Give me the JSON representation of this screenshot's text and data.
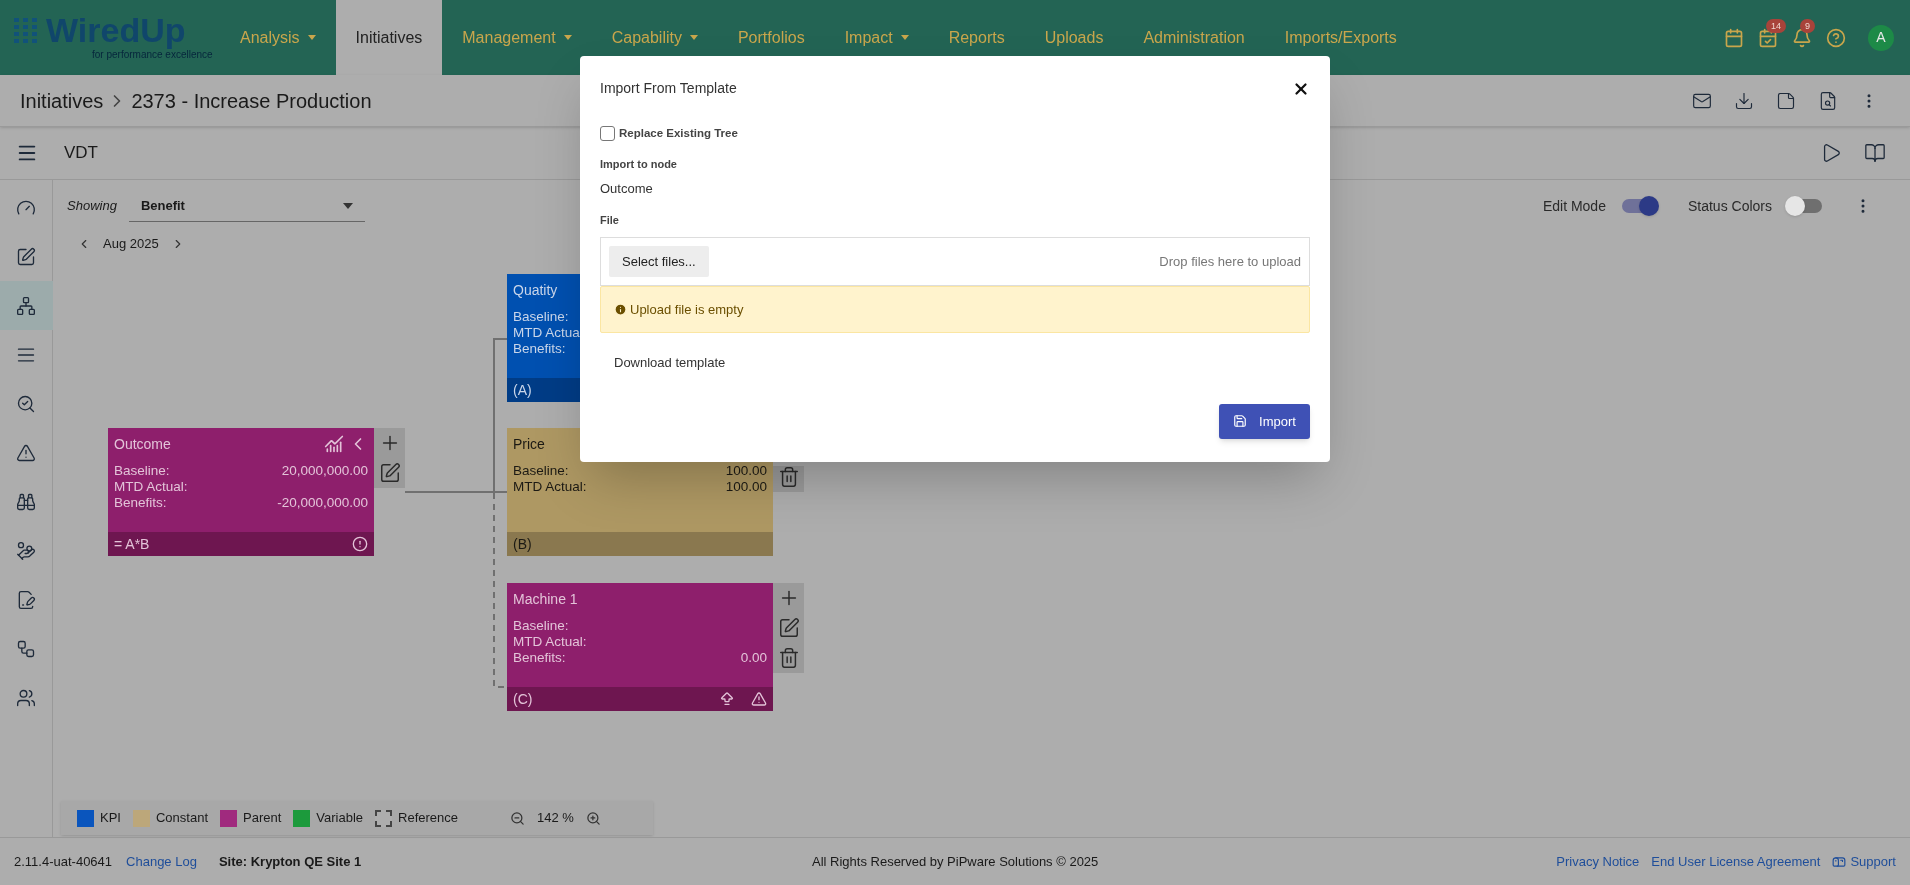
{
  "header": {
    "logo": "WiredUp",
    "tagline": "for performance excellence",
    "nav": [
      {
        "label": "Analysis",
        "selected": false,
        "dropdown": true
      },
      {
        "label": "Initiatives",
        "selected": true,
        "dropdown": false
      },
      {
        "label": "Management",
        "selected": false,
        "dropdown": true
      },
      {
        "label": "Capability",
        "selected": false,
        "dropdown": true
      },
      {
        "label": "Portfolios",
        "selected": false,
        "dropdown": false
      },
      {
        "label": "Impact",
        "selected": false,
        "dropdown": true
      },
      {
        "label": "Reports",
        "selected": false,
        "dropdown": false
      },
      {
        "label": "Uploads",
        "selected": false,
        "dropdown": false
      },
      {
        "label": "Administration",
        "selected": false,
        "dropdown": false
      },
      {
        "label": "Imports/Exports",
        "selected": false,
        "dropdown": false
      }
    ],
    "tools": [
      {
        "kind": "calendar"
      },
      {
        "kind": "tasks",
        "badge": "14"
      },
      {
        "kind": "bell",
        "badge": "9"
      },
      {
        "kind": "help"
      }
    ],
    "avatar": "A"
  },
  "breadcrumb": {
    "parent": "Initiatives",
    "current": "2373 - Increase Production"
  },
  "toolbar": {
    "title": "VDT"
  },
  "rail": [
    {
      "kind": "gauge",
      "selected": false
    },
    {
      "kind": "edit",
      "selected": false
    },
    {
      "kind": "tree",
      "selected": true
    },
    {
      "kind": "list",
      "selected": false
    },
    {
      "kind": "search",
      "selected": false
    },
    {
      "kind": "warning",
      "selected": false
    },
    {
      "kind": "binoculars",
      "selected": false
    },
    {
      "kind": "hand",
      "selected": false
    },
    {
      "kind": "sign",
      "selected": false
    },
    {
      "kind": "network",
      "selected": false
    },
    {
      "kind": "users",
      "selected": false
    }
  ],
  "canvas": {
    "showing_label": "Showing",
    "showing_value": "Benefit",
    "month": "Aug 2025",
    "edit_mode": {
      "label": "Edit Mode",
      "on": true
    },
    "status_colors": {
      "label": "Status Colors",
      "on": false
    },
    "nodes": [
      {
        "kind": "parent",
        "title": "Outcome",
        "rows": [
          {
            "label": "Baseline:",
            "value": "20,000,000.00"
          },
          {
            "label": "MTD Actual:"
          },
          {
            "label": "Benefits:",
            "value": "-20,000,000.00"
          }
        ],
        "footer": "= A*B",
        "actions": [
          {
            "kind": "add"
          },
          {
            "kind": "edit"
          }
        ]
      },
      {
        "kind": "kpi",
        "title": "Quatity",
        "rows": [
          {
            "label": "Baseline:"
          },
          {
            "label": "MTD Actua"
          },
          {
            "label": "Benefits:"
          }
        ],
        "footer": "(A)"
      },
      {
        "kind": "constant",
        "title": "Price",
        "rows": [
          {
            "label": "Baseline:",
            "value": "100.00"
          },
          {
            "label": "MTD Actual:",
            "value": "100.00"
          }
        ],
        "footer": "(B)",
        "actions": [
          {
            "kind": "delete"
          }
        ]
      },
      {
        "kind": "parent",
        "title": "Machine 1",
        "rows": [
          {
            "label": "Baseline:"
          },
          {
            "label": "MTD Actual:"
          },
          {
            "label": "Benefits:",
            "value": "0.00"
          }
        ],
        "footer": "(C)",
        "actions": [
          {
            "kind": "add"
          },
          {
            "kind": "edit"
          },
          {
            "kind": "delete"
          }
        ]
      }
    ],
    "legend": [
      {
        "label": "KPI",
        "color": "#0a55bd"
      },
      {
        "label": "Constant",
        "color": "#bca77a"
      },
      {
        "label": "Parent",
        "color": "#a02a7e"
      },
      {
        "label": "Variable",
        "color": "#1c9a3c"
      },
      {
        "label": "Reference",
        "color": "#adadad"
      }
    ],
    "zoom": "142 %"
  },
  "footer": {
    "version": "2.11.4-uat-40641",
    "change_log": "Change Log",
    "site": "Site: Krypton QE Site 1",
    "copyright": "All Rights Reserved by PiPware Solutions © 2025",
    "links": [
      "Privacy Notice",
      "End User License Agreement"
    ],
    "support": "Support"
  },
  "dialog": {
    "title": "Import From Template",
    "replace": {
      "label": "Replace Existing Tree",
      "checked": false
    },
    "node_label": "Import to node",
    "node_value": "Outcome",
    "file_label": "File",
    "select_button": "Select files...",
    "drop_hint": "Drop files here to upload",
    "warning": "Upload file is empty",
    "download": "Download template",
    "import_button": "Import"
  }
}
